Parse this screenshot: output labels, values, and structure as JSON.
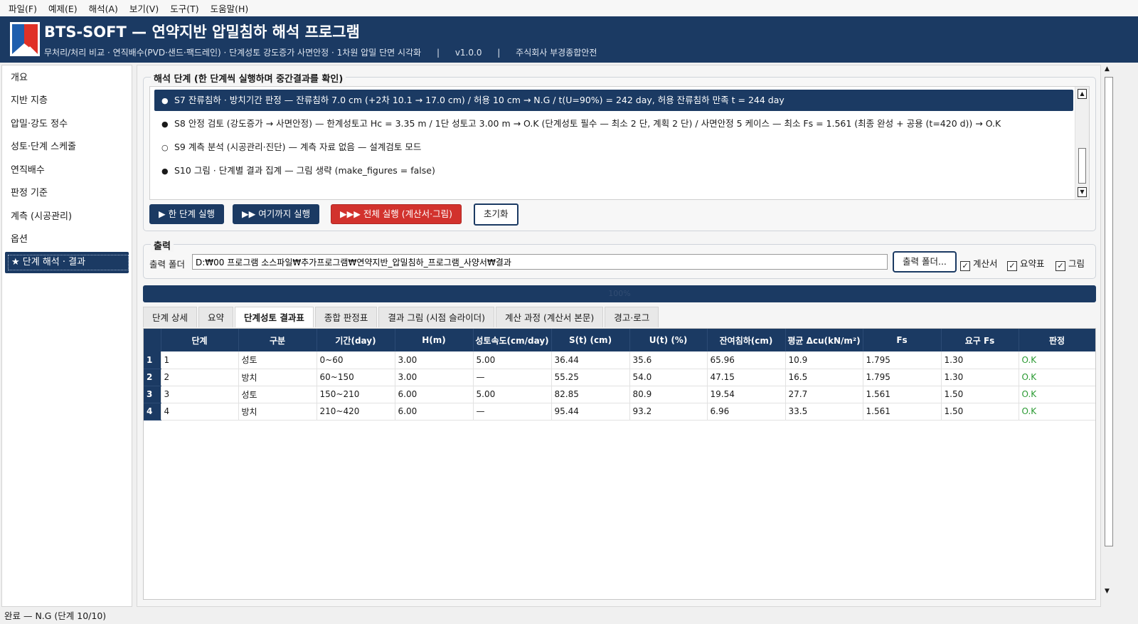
{
  "menu": [
    "파일(F)",
    "예제(E)",
    "해석(A)",
    "보기(V)",
    "도구(T)",
    "도움말(H)"
  ],
  "header": {
    "title": "BTS-SOFT — 연약지반 압밀침하 해석 프로그램",
    "subtitle": "무처리/처리 비교 · 연직배수(PVD·샌드·팩드레인) · 단계성토 강도증가 사면안정 · 1차원 압밀 단면 시각화",
    "sep": "|",
    "version": "v1.0.0",
    "company": "주식회사 부경종합안전"
  },
  "sidebar": {
    "items": [
      "개요",
      "지반 지층",
      "압밀·강도 정수",
      "성토·단계 스케줄",
      "연직배수",
      "판정 기준",
      "계측 (시공관리)",
      "옵션",
      "★ 단계 해석 · 결과"
    ],
    "active_index": 8
  },
  "steps": {
    "title": "해석 단계 (한 단계씩 실행하며 중간결과를 확인)",
    "items": [
      {
        "marker": "●",
        "text": "S7  잔류침하 · 방치기간 판정   —  잔류침하 7.0 cm (+2차 10.1 → 17.0 cm) / 허용 10 cm → N.G / t(U=90%) = 242 day, 허용 잔류침하 만족 t = 244 day"
      },
      {
        "marker": "●",
        "text": "S8  안정 검토 (강도증가 → 사면안정)   —  한계성토고 Hc = 3.35 m / 1단 성토고 3.00 m → O.K (단계성토 필수 — 최소 2 단, 계획 2 단) / 사면안정 5 케이스 — 최소 Fs = 1.561 (최종 완성 + 공용 (t=420 d)) → O.K"
      },
      {
        "marker": "○",
        "text": "S9  계측 분석 (시공관리·진단)   —  계측 자료 없음 — 설계검토 모드"
      },
      {
        "marker": "●",
        "text": "S10  그림 · 단계별 결과 집계   —  그림 생략 (make_figures = false)"
      }
    ],
    "selected_index": 0,
    "buttons": {
      "step": "▶ 한 단계 실행",
      "until": "▶▶ 여기까지 실행",
      "all": "▶▶▶ 전체 실행 (계산서·그림)",
      "reset": "초기화"
    }
  },
  "output": {
    "title": "출력",
    "folder_label": "출력 폴더",
    "folder_value": "D:₩00 프로그램 소스파일₩추가프로그램₩연약지반_압밀침하_프로그램_사양서₩결과",
    "browse_button": "출력 폴더...",
    "checks": [
      {
        "label": "계산서",
        "checked": true
      },
      {
        "label": "요약표",
        "checked": true
      },
      {
        "label": "그림",
        "checked": true
      }
    ]
  },
  "progress": {
    "value": 100,
    "label": "100%"
  },
  "tabs": {
    "items": [
      "단계 상세",
      "요약",
      "단계성토 결과표",
      "종합 판정표",
      "결과 그림 (시점 슬라이더)",
      "계산 과정 (계산서 본문)",
      "경고·로그"
    ],
    "active_index": 2
  },
  "table": {
    "headers": [
      "단계",
      "구분",
      "기간(day)",
      "H(m)",
      "성토속도(cm/day)",
      "S(t) (cm)",
      "U(t) (%)",
      "잔여침하(cm)",
      "평균 Δcu(kN/m²)",
      "Fs",
      "요구 Fs",
      "판정"
    ],
    "rows": [
      {
        "num": "1",
        "cells": [
          "1",
          "성토",
          "0~60",
          "3.00",
          "5.00",
          "36.44",
          "35.6",
          "65.96",
          "10.9",
          "1.795",
          "1.30",
          "O.K"
        ]
      },
      {
        "num": "2",
        "cells": [
          "2",
          "방치",
          "60~150",
          "3.00",
          "—",
          "55.25",
          "54.0",
          "47.15",
          "16.5",
          "1.795",
          "1.30",
          "O.K"
        ]
      },
      {
        "num": "3",
        "cells": [
          "3",
          "성토",
          "150~210",
          "6.00",
          "5.00",
          "82.85",
          "80.9",
          "19.54",
          "27.7",
          "1.561",
          "1.50",
          "O.K"
        ]
      },
      {
        "num": "4",
        "cells": [
          "4",
          "방치",
          "210~420",
          "6.00",
          "—",
          "95.44",
          "93.2",
          "6.96",
          "33.5",
          "1.561",
          "1.50",
          "O.K"
        ]
      }
    ]
  },
  "status": "완료 — N.G (단계 10/10)",
  "colors": {
    "navy": "#1b3a63",
    "red": "#d2322d",
    "ok_green": "#2a9a32"
  }
}
